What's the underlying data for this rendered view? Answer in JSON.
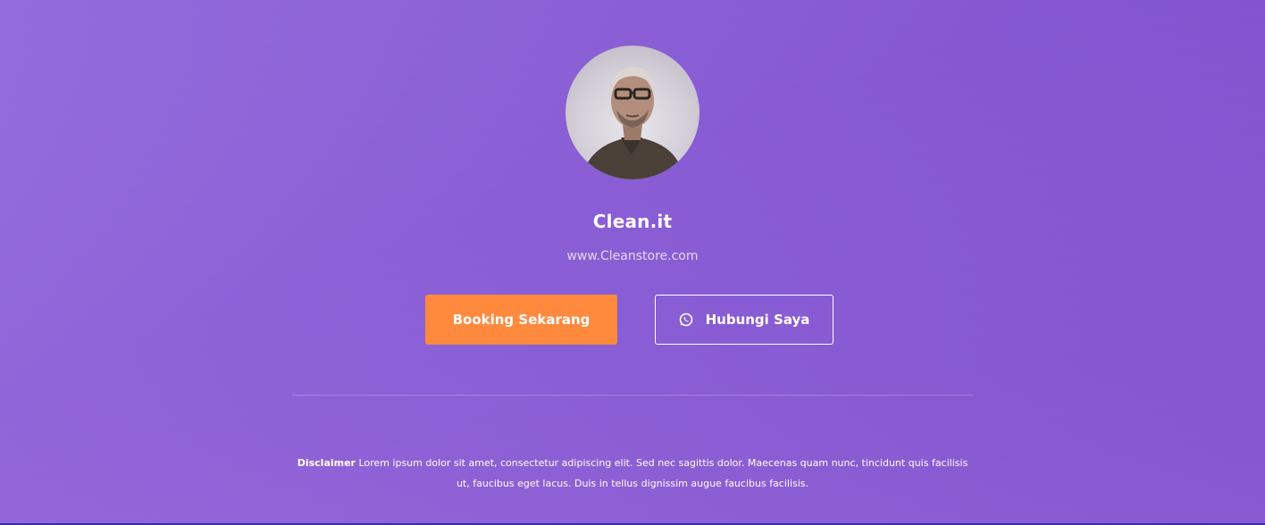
{
  "profile": {
    "name": "Clean.it",
    "website": "www.Cleanstore.com"
  },
  "actions": {
    "booking_label": "Booking Sekarang",
    "contact_label": "Hubungi Saya",
    "contact_icon": "whatsapp-icon"
  },
  "footer": {
    "disclaimer_title": "Disclaimer",
    "disclaimer_text": "Lorem ipsum dolor sit amet, consectetur adipiscing elit. Sed nec sagittis dolor. Maecenas quam nunc, tincidunt quis facilisis ut, faucibus eget lacus. Duis in tellus dignissim augue faucibus facilisis."
  },
  "colors": {
    "accent": "#ff8a3d",
    "background_top": "#7848c8",
    "background_bottom": "#b48ae8",
    "text": "#ffffff"
  }
}
